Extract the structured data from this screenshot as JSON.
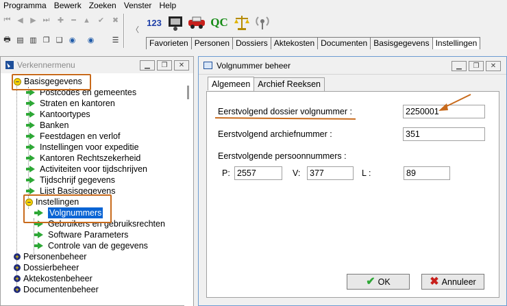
{
  "menu": [
    "Programma",
    "Bewerk",
    "Zoeken",
    "Venster",
    "Help"
  ],
  "toolbar": {
    "big_buttons": [
      {
        "name": "numbering-icon",
        "label": "123"
      },
      {
        "name": "monitor-icon",
        "label": ""
      },
      {
        "name": "car-icon",
        "label": ""
      },
      {
        "name": "qc-icon",
        "label": "QC"
      },
      {
        "name": "scales-icon",
        "label": ""
      },
      {
        "name": "radio-icon",
        "label": ""
      }
    ],
    "tabs": [
      "Favorieten",
      "Personen",
      "Dossiers",
      "Aktekosten",
      "Documenten",
      "Basisgegevens",
      "Instellingen"
    ],
    "active_tab": "Instellingen"
  },
  "tree": {
    "title": "Verkennermenu",
    "nodes": {
      "basisgegevens": "Basisgegevens",
      "postcodes": "Postcodes en gemeentes",
      "straten": "Straten en kantoren",
      "kantoortypes": "Kantoortypes",
      "banken": "Banken",
      "feestdagen": "Feestdagen en verlof",
      "expeditie": "Instellingen voor expeditie",
      "kantoren_rz": "Kantoren Rechtszekerheid",
      "activiteiten": "Activiteiten voor tijdschrijven",
      "tijdschrijf": "Tijdschrijf gegevens",
      "lijst": "Lijst Basisgegevens",
      "instellingen": "Instellingen",
      "volgnummers": "Volgnummers",
      "gebruikers": "Gebruikers en gebruiksrechten",
      "software": "Software Parameters",
      "controle": "Controle van de gegevens",
      "personenbeheer": "Personenbeheer",
      "dossierbeheer": "Dossierbeheer",
      "aktekostenbeheer": "Aktekostenbeheer",
      "documentenbeheer": "Documentenbeheer"
    }
  },
  "dialog": {
    "title": "Volgnummer beheer",
    "tabs": [
      "Algemeen",
      "Archief Reeksen"
    ],
    "active_tab": "Algemeen",
    "dossier_label": "Eerstvolgend dossier volgnummer :",
    "dossier_value": "2250001",
    "archief_label": "Eerstvolgend archiefnummer :",
    "archief_value": "351",
    "persoon_label": "Eerstvolgende persoonnummers :",
    "p_label": "P:",
    "p_value": "2557",
    "v_label": "V:",
    "v_value": "377",
    "l_label": "L :",
    "l_value": "89",
    "ok_label": "OK",
    "cancel_label": "Annuleer"
  },
  "colors": {
    "highlight": "#c86a1b",
    "selection": "#0a64d4",
    "arrow_green": "#2ea836"
  }
}
